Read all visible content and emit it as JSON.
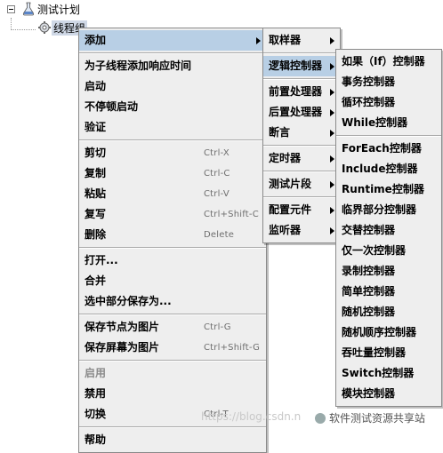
{
  "tree": {
    "root_label": "测试计划",
    "child_label": "线程组"
  },
  "main_menu": [
    {
      "label": "添加",
      "submenu": true,
      "highlighted": true
    },
    {
      "separator": true
    },
    {
      "label": "为子线程添加响应时间"
    },
    {
      "label": "启动"
    },
    {
      "label": "不停顿启动"
    },
    {
      "label": "验证"
    },
    {
      "separator": true
    },
    {
      "label": "剪切",
      "shortcut": "Ctrl-X"
    },
    {
      "label": "复制",
      "shortcut": "Ctrl-C"
    },
    {
      "label": "粘贴",
      "shortcut": "Ctrl-V"
    },
    {
      "label": "复写",
      "shortcut": "Ctrl+Shift-C"
    },
    {
      "label": "删除",
      "shortcut": "Delete"
    },
    {
      "separator": true
    },
    {
      "label": "打开..."
    },
    {
      "label": "合并"
    },
    {
      "label": "选中部分保存为..."
    },
    {
      "separator": true
    },
    {
      "label": "保存节点为图片",
      "shortcut": "Ctrl-G"
    },
    {
      "label": "保存屏幕为图片",
      "shortcut": "Ctrl+Shift-G"
    },
    {
      "separator": true
    },
    {
      "label": "启用",
      "disabled": true
    },
    {
      "label": "禁用"
    },
    {
      "label": "切换",
      "shortcut": "Ctrl-T"
    },
    {
      "separator": true
    },
    {
      "label": "帮助"
    }
  ],
  "add_menu": [
    {
      "label": "取样器",
      "submenu": true
    },
    {
      "separator": true
    },
    {
      "label": "逻辑控制器",
      "submenu": true,
      "highlighted": true
    },
    {
      "separator": true
    },
    {
      "label": "前置处理器",
      "submenu": true
    },
    {
      "label": "后置处理器",
      "submenu": true
    },
    {
      "label": "断言",
      "submenu": true
    },
    {
      "separator": true
    },
    {
      "label": "定时器",
      "submenu": true
    },
    {
      "separator": true
    },
    {
      "label": "测试片段",
      "submenu": true
    },
    {
      "separator": true
    },
    {
      "label": "配置元件",
      "submenu": true
    },
    {
      "label": "监听器",
      "submenu": true
    }
  ],
  "logic_menu": [
    {
      "label": "如果（If）控制器"
    },
    {
      "label": "事务控制器"
    },
    {
      "label": "循环控制器"
    },
    {
      "label": "While控制器"
    },
    {
      "separator": true
    },
    {
      "label": "ForEach控制器"
    },
    {
      "label": "Include控制器"
    },
    {
      "label": "Runtime控制器"
    },
    {
      "label": "临界部分控制器"
    },
    {
      "label": "交替控制器"
    },
    {
      "label": "仅一次控制器"
    },
    {
      "label": "录制控制器"
    },
    {
      "label": "简单控制器"
    },
    {
      "label": "随机控制器"
    },
    {
      "label": "随机顺序控制器"
    },
    {
      "label": "吞吐量控制器"
    },
    {
      "label": "Switch控制器"
    },
    {
      "label": "模块控制器"
    }
  ],
  "watermark": {
    "url_text": "https://blog.csdn.n",
    "badge_text": "软件测试资源共享站"
  },
  "colors": {
    "menu_bg": "#eeeeee",
    "highlight": "#b8cfe5",
    "disabled_text": "#8a8a8a"
  }
}
